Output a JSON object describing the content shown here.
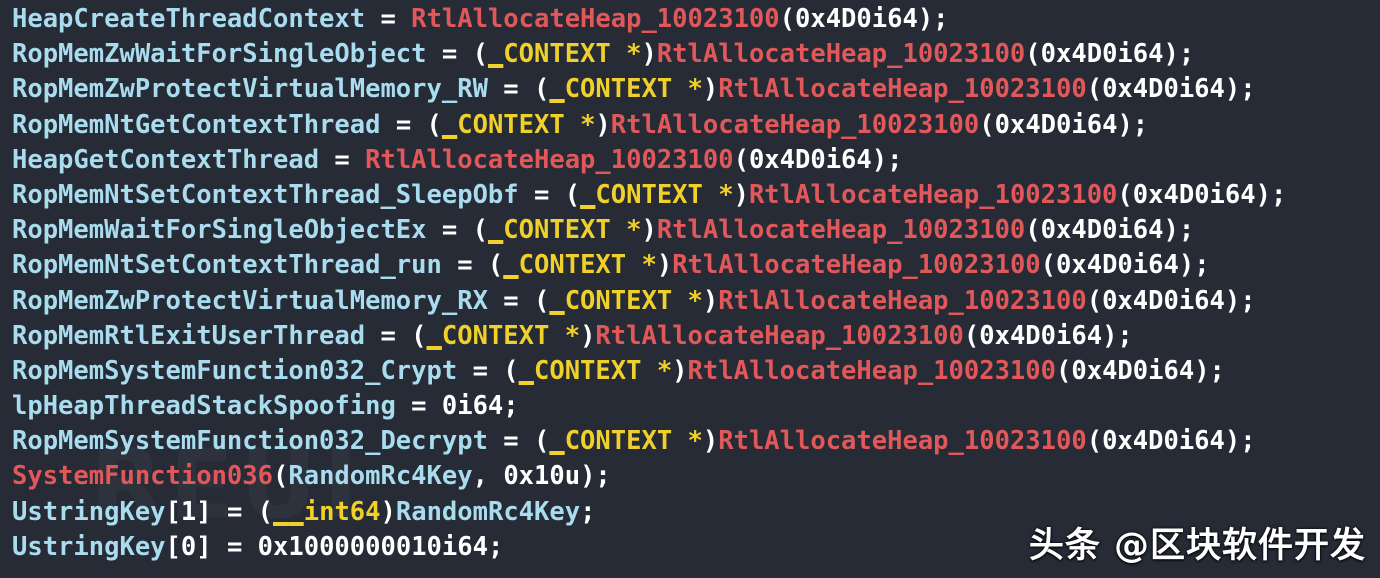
{
  "editor": {
    "name": "decompiler-pseudocode-view",
    "background_color": "#262b36",
    "colors": {
      "variable": "#a8dcee",
      "function": "#e0585a",
      "type_keyword": "#f0d02a",
      "punctuation": "#ffffff",
      "number": "#ffffff"
    },
    "background_watermark_text": "REUI"
  },
  "watermark": {
    "text": "头条 @区块软件开发"
  },
  "code": {
    "language": "c-pseudocode",
    "line_count": 16,
    "lines": [
      {
        "index": 0,
        "text": "HeapCreateThreadContext = RtlAllocateHeap_10023100(0x4D0i64);",
        "tokens": [
          {
            "t": "HeapCreateThreadContext",
            "c": "var"
          },
          {
            "t": " = ",
            "c": "punct"
          },
          {
            "t": "RtlAllocateHeap_10023100",
            "c": "func"
          },
          {
            "t": "(",
            "c": "punct"
          },
          {
            "t": "0x4D0i64",
            "c": "num"
          },
          {
            "t": ");",
            "c": "punct"
          }
        ]
      },
      {
        "index": 1,
        "text": "RopMemZwWaitForSingleObject = (_CONTEXT *)RtlAllocateHeap_10023100(0x4D0i64);",
        "tokens": [
          {
            "t": "RopMemZwWaitForSingleObject",
            "c": "var"
          },
          {
            "t": " = (",
            "c": "punct"
          },
          {
            "t": "_",
            "c": "type-under"
          },
          {
            "t": "CONTEXT *",
            "c": "type"
          },
          {
            "t": ")",
            "c": "punct"
          },
          {
            "t": "RtlAllocateHeap_10023100",
            "c": "func"
          },
          {
            "t": "(",
            "c": "punct"
          },
          {
            "t": "0x4D0i64",
            "c": "num"
          },
          {
            "t": ");",
            "c": "punct"
          }
        ]
      },
      {
        "index": 2,
        "text": "RopMemZwProtectVirtualMemory_RW = (_CONTEXT *)RtlAllocateHeap_10023100(0x4D0i64);",
        "tokens": [
          {
            "t": "RopMemZwProtectVirtualMemory_RW",
            "c": "var"
          },
          {
            "t": " = (",
            "c": "punct"
          },
          {
            "t": "_",
            "c": "type-under"
          },
          {
            "t": "CONTEXT *",
            "c": "type"
          },
          {
            "t": ")",
            "c": "punct"
          },
          {
            "t": "RtlAllocateHeap_10023100",
            "c": "func"
          },
          {
            "t": "(",
            "c": "punct"
          },
          {
            "t": "0x4D0i64",
            "c": "num"
          },
          {
            "t": ");",
            "c": "punct"
          }
        ]
      },
      {
        "index": 3,
        "text": "RopMemNtGetContextThread = (_CONTEXT *)RtlAllocateHeap_10023100(0x4D0i64);",
        "tokens": [
          {
            "t": "RopMemNtGetContextThread",
            "c": "var"
          },
          {
            "t": " = (",
            "c": "punct"
          },
          {
            "t": "_",
            "c": "type-under"
          },
          {
            "t": "CONTEXT *",
            "c": "type"
          },
          {
            "t": ")",
            "c": "punct"
          },
          {
            "t": "RtlAllocateHeap_10023100",
            "c": "func"
          },
          {
            "t": "(",
            "c": "punct"
          },
          {
            "t": "0x4D0i64",
            "c": "num"
          },
          {
            "t": ");",
            "c": "punct"
          }
        ]
      },
      {
        "index": 4,
        "text": "HeapGetContextThread = RtlAllocateHeap_10023100(0x4D0i64);",
        "tokens": [
          {
            "t": "HeapGetContextThread",
            "c": "var"
          },
          {
            "t": " = ",
            "c": "punct"
          },
          {
            "t": "RtlAllocateHeap_10023100",
            "c": "func"
          },
          {
            "t": "(",
            "c": "punct"
          },
          {
            "t": "0x4D0i64",
            "c": "num"
          },
          {
            "t": ");",
            "c": "punct"
          }
        ]
      },
      {
        "index": 5,
        "text": "RopMemNtSetContextThread_SleepObf = (_CONTEXT *)RtlAllocateHeap_10023100(0x4D0i64);",
        "tokens": [
          {
            "t": "RopMemNtSetContextThread_SleepObf",
            "c": "var"
          },
          {
            "t": " = (",
            "c": "punct"
          },
          {
            "t": "_",
            "c": "type-under"
          },
          {
            "t": "CONTEXT *",
            "c": "type"
          },
          {
            "t": ")",
            "c": "punct"
          },
          {
            "t": "RtlAllocateHeap_10023100",
            "c": "func"
          },
          {
            "t": "(",
            "c": "punct"
          },
          {
            "t": "0x4D0i64",
            "c": "num"
          },
          {
            "t": ");",
            "c": "punct"
          }
        ]
      },
      {
        "index": 6,
        "text": "RopMemWaitForSingleObjectEx = (_CONTEXT *)RtlAllocateHeap_10023100(0x4D0i64);",
        "tokens": [
          {
            "t": "RopMemWaitForSingleObjectEx",
            "c": "var"
          },
          {
            "t": " = (",
            "c": "punct"
          },
          {
            "t": "_",
            "c": "type-under"
          },
          {
            "t": "CONTEXT *",
            "c": "type"
          },
          {
            "t": ")",
            "c": "punct"
          },
          {
            "t": "RtlAllocateHeap_10023100",
            "c": "func"
          },
          {
            "t": "(",
            "c": "punct"
          },
          {
            "t": "0x4D0i64",
            "c": "num"
          },
          {
            "t": ");",
            "c": "punct"
          }
        ]
      },
      {
        "index": 7,
        "text": "RopMemNtSetContextThread_run = (_CONTEXT *)RtlAllocateHeap_10023100(0x4D0i64);",
        "tokens": [
          {
            "t": "RopMemNtSetContextThread_run",
            "c": "var"
          },
          {
            "t": " = (",
            "c": "punct"
          },
          {
            "t": "_",
            "c": "type-under"
          },
          {
            "t": "CONTEXT *",
            "c": "type"
          },
          {
            "t": ")",
            "c": "punct"
          },
          {
            "t": "RtlAllocateHeap_10023100",
            "c": "func"
          },
          {
            "t": "(",
            "c": "punct"
          },
          {
            "t": "0x4D0i64",
            "c": "num"
          },
          {
            "t": ");",
            "c": "punct"
          }
        ]
      },
      {
        "index": 8,
        "text": "RopMemZwProtectVirtualMemory_RX = (_CONTEXT *)RtlAllocateHeap_10023100(0x4D0i64);",
        "tokens": [
          {
            "t": "RopMemZwProtectVirtualMemory_RX",
            "c": "var"
          },
          {
            "t": " = (",
            "c": "punct"
          },
          {
            "t": "_",
            "c": "type-under"
          },
          {
            "t": "CONTEXT *",
            "c": "type"
          },
          {
            "t": ")",
            "c": "punct"
          },
          {
            "t": "RtlAllocateHeap_10023100",
            "c": "func"
          },
          {
            "t": "(",
            "c": "punct"
          },
          {
            "t": "0x4D0i64",
            "c": "num"
          },
          {
            "t": ");",
            "c": "punct"
          }
        ]
      },
      {
        "index": 9,
        "text": "RopMemRtlExitUserThread = (_CONTEXT *)RtlAllocateHeap_10023100(0x4D0i64);",
        "tokens": [
          {
            "t": "RopMemRtlExitUserThread",
            "c": "var"
          },
          {
            "t": " = (",
            "c": "punct"
          },
          {
            "t": "_",
            "c": "type-under"
          },
          {
            "t": "CONTEXT *",
            "c": "type"
          },
          {
            "t": ")",
            "c": "punct"
          },
          {
            "t": "RtlAllocateHeap_10023100",
            "c": "func"
          },
          {
            "t": "(",
            "c": "punct"
          },
          {
            "t": "0x4D0i64",
            "c": "num"
          },
          {
            "t": ");",
            "c": "punct"
          }
        ]
      },
      {
        "index": 10,
        "text": "RopMemSystemFunction032_Crypt = (_CONTEXT *)RtlAllocateHeap_10023100(0x4D0i64);",
        "tokens": [
          {
            "t": "RopMemSystemFunction032_Crypt",
            "c": "var"
          },
          {
            "t": " = (",
            "c": "punct"
          },
          {
            "t": "_",
            "c": "type-under"
          },
          {
            "t": "CONTEXT *",
            "c": "type"
          },
          {
            "t": ")",
            "c": "punct"
          },
          {
            "t": "RtlAllocateHeap_10023100",
            "c": "func"
          },
          {
            "t": "(",
            "c": "punct"
          },
          {
            "t": "0x4D0i64",
            "c": "num"
          },
          {
            "t": ");",
            "c": "punct"
          }
        ]
      },
      {
        "index": 11,
        "text": "lpHeapThreadStackSpoofing = 0i64;",
        "tokens": [
          {
            "t": "lpHeapThreadStackSpoofing",
            "c": "var"
          },
          {
            "t": " = ",
            "c": "punct"
          },
          {
            "t": "0i64",
            "c": "num"
          },
          {
            "t": ";",
            "c": "punct"
          }
        ]
      },
      {
        "index": 12,
        "text": "RopMemSystemFunction032_Decrypt = (_CONTEXT *)RtlAllocateHeap_10023100(0x4D0i64);",
        "tokens": [
          {
            "t": "RopMemSystemFunction032_Decrypt",
            "c": "var"
          },
          {
            "t": " = (",
            "c": "punct"
          },
          {
            "t": "_",
            "c": "type-under"
          },
          {
            "t": "CONTEXT *",
            "c": "type"
          },
          {
            "t": ")",
            "c": "punct"
          },
          {
            "t": "RtlAllocateHeap_10023100",
            "c": "func"
          },
          {
            "t": "(",
            "c": "punct"
          },
          {
            "t": "0x4D0i64",
            "c": "num"
          },
          {
            "t": ");",
            "c": "punct"
          }
        ]
      },
      {
        "index": 13,
        "text": "SystemFunction036(RandomRc4Key, 0x10u);",
        "tokens": [
          {
            "t": "SystemFunction036",
            "c": "func"
          },
          {
            "t": "(",
            "c": "punct"
          },
          {
            "t": "RandomRc4Key",
            "c": "var"
          },
          {
            "t": ", ",
            "c": "punct"
          },
          {
            "t": "0x10u",
            "c": "num"
          },
          {
            "t": ");",
            "c": "punct"
          }
        ]
      },
      {
        "index": 14,
        "text": "UstringKey[1] = (__int64)RandomRc4Key;",
        "tokens": [
          {
            "t": "UstringKey",
            "c": "var"
          },
          {
            "t": "[",
            "c": "punct"
          },
          {
            "t": "1",
            "c": "num"
          },
          {
            "t": "] = (",
            "c": "punct"
          },
          {
            "t": "__",
            "c": "type-under"
          },
          {
            "t": "int64",
            "c": "type"
          },
          {
            "t": ")",
            "c": "punct"
          },
          {
            "t": "RandomRc4Key",
            "c": "var"
          },
          {
            "t": ";",
            "c": "punct"
          }
        ]
      },
      {
        "index": 15,
        "text": "UstringKey[0] = 0x1000000010i64;",
        "tokens": [
          {
            "t": "UstringKey",
            "c": "var"
          },
          {
            "t": "[",
            "c": "punct"
          },
          {
            "t": "0",
            "c": "num"
          },
          {
            "t": "] = ",
            "c": "punct"
          },
          {
            "t": "0x1000000010i64",
            "c": "num"
          },
          {
            "t": ";",
            "c": "punct"
          }
        ]
      }
    ]
  }
}
